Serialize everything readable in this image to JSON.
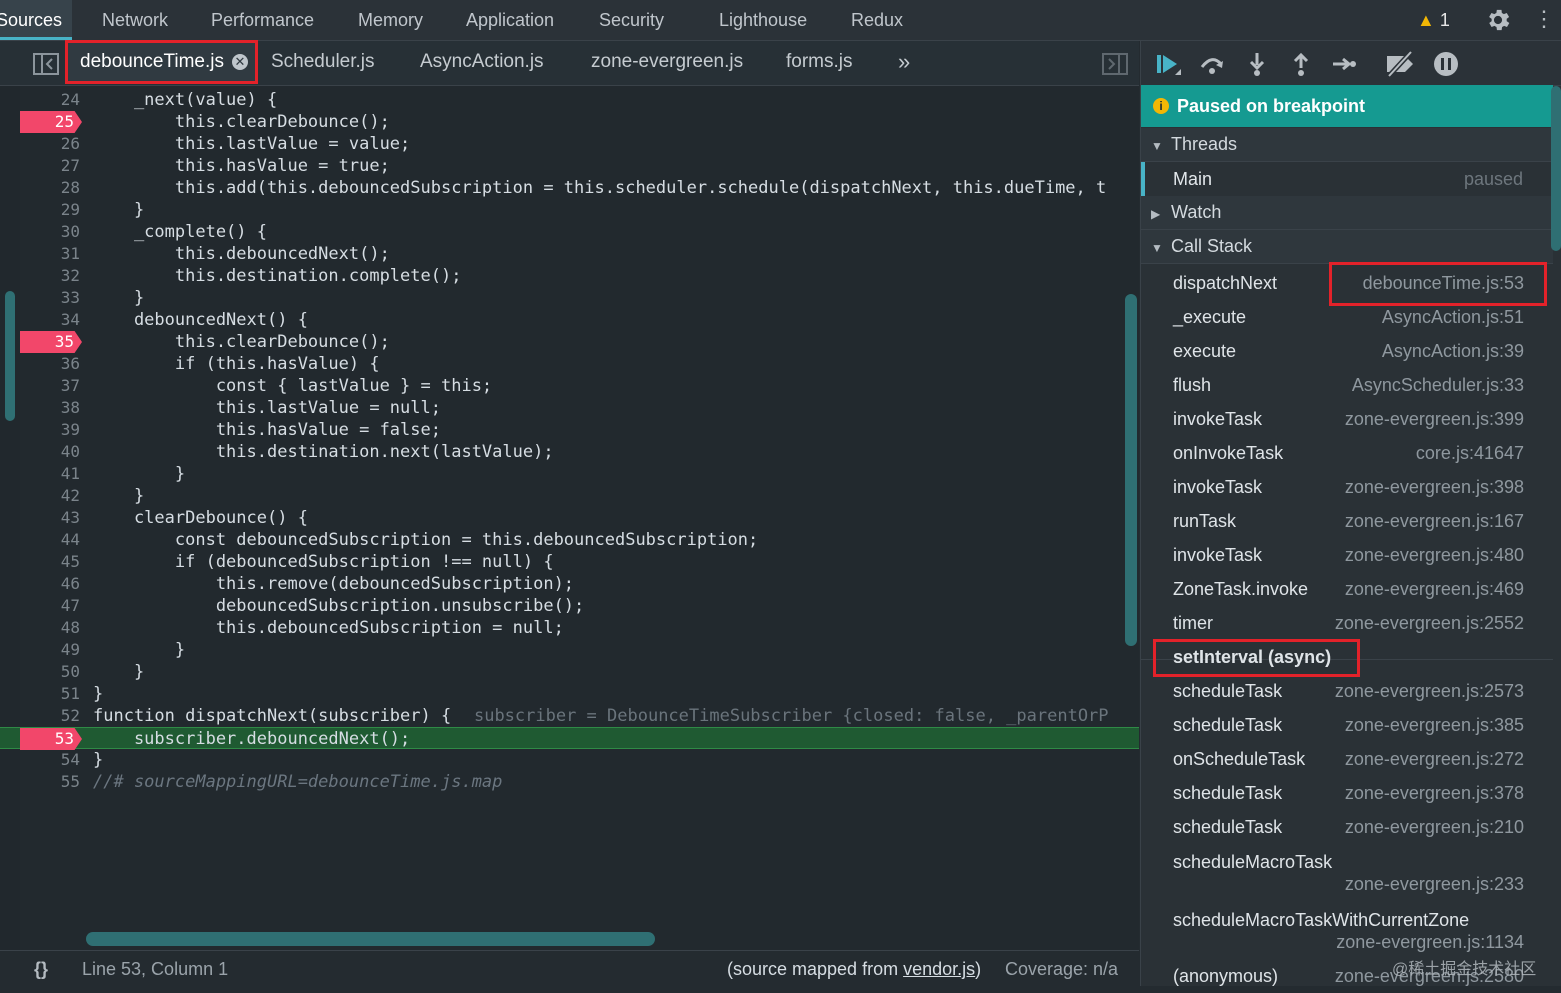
{
  "top_tabs": {
    "items": [
      "Sources",
      "Network",
      "Performance",
      "Memory",
      "Application",
      "Security",
      "Lighthouse",
      "Redux"
    ],
    "warning_count": "1"
  },
  "file_tabs": {
    "items": [
      "debounceTime.js",
      "Scheduler.js",
      "AsyncAction.js",
      "zone-evergreen.js",
      "forms.js"
    ],
    "more": "»",
    "close": "✕"
  },
  "code": [
    {
      "n": "24",
      "t": "    _next(value) {"
    },
    {
      "n": "25",
      "t": "        this.clearDebounce();",
      "bp": true
    },
    {
      "n": "26",
      "t": "        this.lastValue = value;"
    },
    {
      "n": "27",
      "t": "        this.hasValue = true;"
    },
    {
      "n": "28",
      "t": "        this.add(this.debouncedSubscription = this.scheduler.schedule(dispatchNext, this.dueTime, t"
    },
    {
      "n": "29",
      "t": "    }"
    },
    {
      "n": "30",
      "t": "    _complete() {"
    },
    {
      "n": "31",
      "t": "        this.debouncedNext();"
    },
    {
      "n": "32",
      "t": "        this.destination.complete();"
    },
    {
      "n": "33",
      "t": "    }"
    },
    {
      "n": "34",
      "t": "    debouncedNext() {"
    },
    {
      "n": "35",
      "t": "        this.clearDebounce();",
      "bp": true
    },
    {
      "n": "36",
      "t": "        if (this.hasValue) {"
    },
    {
      "n": "37",
      "t": "            const { lastValue } = this;"
    },
    {
      "n": "38",
      "t": "            this.lastValue = null;"
    },
    {
      "n": "39",
      "t": "            this.hasValue = false;"
    },
    {
      "n": "40",
      "t": "            this.destination.next(lastValue);"
    },
    {
      "n": "41",
      "t": "        }"
    },
    {
      "n": "42",
      "t": "    }"
    },
    {
      "n": "43",
      "t": "    clearDebounce() {"
    },
    {
      "n": "44",
      "t": "        const debouncedSubscription = this.debouncedSubscription;"
    },
    {
      "n": "45",
      "t": "        if (debouncedSubscription !== null) {"
    },
    {
      "n": "46",
      "t": "            this.remove(debouncedSubscription);"
    },
    {
      "n": "47",
      "t": "            debouncedSubscription.unsubscribe();"
    },
    {
      "n": "48",
      "t": "            this.debouncedSubscription = null;"
    },
    {
      "n": "49",
      "t": "        }"
    },
    {
      "n": "50",
      "t": "    }"
    },
    {
      "n": "51",
      "t": "}"
    },
    {
      "n": "52",
      "t": "function dispatchNext(subscriber) {",
      "inline": "  subscriber = DebounceTimeSubscriber {closed: false, _parentOrP"
    },
    {
      "n": "53",
      "t": "    subscriber.debouncedNext();",
      "bp": true,
      "current": true
    },
    {
      "n": "54",
      "t": "}"
    },
    {
      "n": "55",
      "t": "//# sourceMappingURL=debounceTime.js.map",
      "comment": true
    }
  ],
  "status": {
    "braces": "{}",
    "position": "Line 53, Column 1",
    "mapped_prefix": "(source mapped from ",
    "mapped_link": "vendor.js",
    "mapped_suffix": ")",
    "coverage": "Coverage: n/a"
  },
  "debugger": {
    "paused_label": "Paused on breakpoint",
    "threads_label": "Threads",
    "thread_main": "Main",
    "thread_state": "paused",
    "watch_label": "Watch",
    "callstack_label": "Call Stack",
    "frames": [
      {
        "fn": "dispatchNext",
        "loc": "debounceTime.js:53"
      },
      {
        "fn": "_execute",
        "loc": "AsyncAction.js:51"
      },
      {
        "fn": "execute",
        "loc": "AsyncAction.js:39"
      },
      {
        "fn": "flush",
        "loc": "AsyncScheduler.js:33"
      },
      {
        "fn": "invokeTask",
        "loc": "zone-evergreen.js:399"
      },
      {
        "fn": "onInvokeTask",
        "loc": "core.js:41647"
      },
      {
        "fn": "invokeTask",
        "loc": "zone-evergreen.js:398"
      },
      {
        "fn": "runTask",
        "loc": "zone-evergreen.js:167"
      },
      {
        "fn": "invokeTask",
        "loc": "zone-evergreen.js:480"
      },
      {
        "fn": "ZoneTask.invoke",
        "loc": "zone-evergreen.js:469"
      },
      {
        "fn": "timer",
        "loc": "zone-evergreen.js:2552"
      }
    ],
    "async_label": "setInterval (async)",
    "async_frames": [
      {
        "fn": "scheduleTask",
        "loc": "zone-evergreen.js:2573"
      },
      {
        "fn": "scheduleTask",
        "loc": "zone-evergreen.js:385"
      },
      {
        "fn": "onScheduleTask",
        "loc": "zone-evergreen.js:272"
      },
      {
        "fn": "scheduleTask",
        "loc": "zone-evergreen.js:378"
      },
      {
        "fn": "scheduleTask",
        "loc": "zone-evergreen.js:210"
      }
    ],
    "tall_frames": [
      {
        "fn": "scheduleMacroTask",
        "loc": "zone-evergreen.js:233"
      },
      {
        "fn": "scheduleMacroTaskWithCurrentZone",
        "loc": "zone-evergreen.js:1134"
      }
    ],
    "last_frame": {
      "fn": "(anonymous)",
      "loc": "zone-evergreen.js:2580"
    }
  },
  "watermark": "@稀土掘金技术社区",
  "colors": {
    "accent": "#48b3c7",
    "breakpoint": "#f2476a",
    "paused_bg": "#159a91",
    "highlight": "#e3222a"
  }
}
